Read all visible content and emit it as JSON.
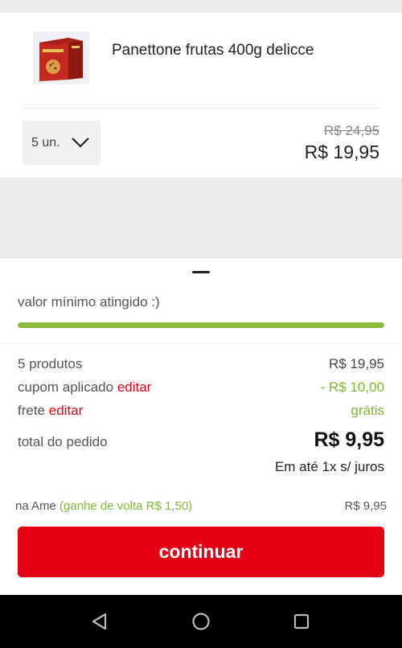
{
  "product": {
    "name": "Panettone frutas 400g delicce",
    "image_icon": "panettone-box-image",
    "quantity": "5 un.",
    "price_old": "R$ 24,95",
    "price_new": "R$ 19,95"
  },
  "summary": {
    "min_value_text": "valor mínimo atingido :)",
    "progress": 1.0,
    "products_label": "5 produtos",
    "products_value": "R$ 19,95",
    "coupon_label": "cupom aplicado",
    "coupon_edit": "editar",
    "coupon_value": "- R$ 10,00",
    "shipping_label": "frete",
    "shipping_edit": "editar",
    "shipping_value": "grátis",
    "total_label": "total do pedido",
    "total_value": "R$ 9,95",
    "installments": "Em até 1x s/ juros"
  },
  "ame": {
    "label": "na Ame",
    "cashback": "(ganhe de volta R$ 1,50)",
    "value": "R$ 9,95"
  },
  "continue_label": "continuar",
  "colors": {
    "accent_red": "#e60014",
    "accent_green": "#7fb82e",
    "progress_green": "#8bba3c"
  },
  "nav": [
    "back-icon",
    "home-icon",
    "recents-icon"
  ]
}
